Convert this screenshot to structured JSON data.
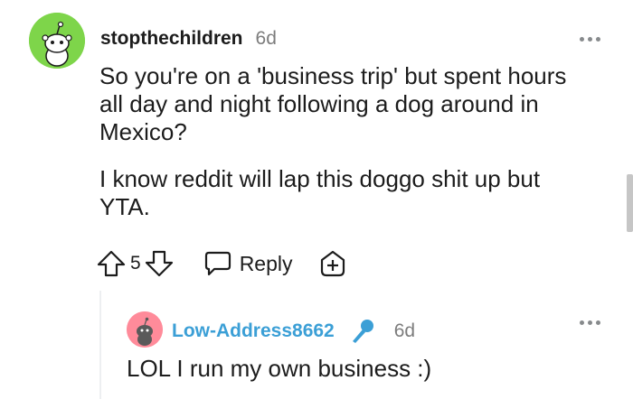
{
  "comment": {
    "username": "stopthechildren",
    "age": "6d",
    "paragraphs": [
      "So you're on a 'business trip' but spent hours all day and night following a dog around in Mexico?",
      "I know reddit will lap this doggo shit up but YTA."
    ],
    "score": "5",
    "reply_label": "Reply"
  },
  "reply": {
    "username": "Low-Address8662",
    "age": "6d",
    "text": "LOL I run my own business :)"
  },
  "colors": {
    "avatar_main_bg": "#7ed54a",
    "avatar_reply_bg": "#ff8b9a",
    "reply_username": "#3b9fd6",
    "badge_icon": "#3b9fd6"
  },
  "icons": {
    "upvote": "upvote-arrow-icon",
    "downvote": "downvote-arrow-icon",
    "reply": "speech-bubble-icon",
    "award": "award-plus-icon",
    "more": "more-options-icon",
    "badge": "microphone-icon"
  }
}
